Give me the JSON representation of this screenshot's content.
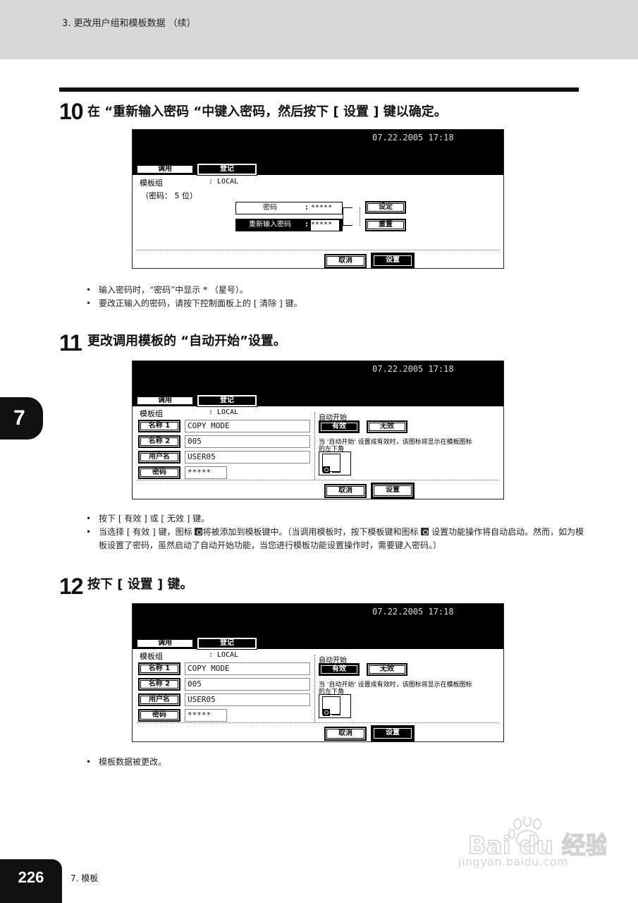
{
  "header": {
    "title": "3. 更改用户组和模板数据 （续）"
  },
  "steps": [
    {
      "num": "10",
      "text": "在 “重新输入密码 “中键入密码，然后按下 [ 设置 ] 键以确定。",
      "bullets": [
        "输入密码时，“密码”中显示 * （星号）。",
        "要改正输入的密码，请按下控制面板上的 [ 清除 ] 键。"
      ]
    },
    {
      "num": "11",
      "text": "更改调用模板的 “自动开始”设置。",
      "bullets": [
        "按下 [ 有效 ] 或 [ 无效 ] 键。",
        "当选择 [ 有效 ] 键，图标",
        "将被添加到模板键中。（当调用模板时，按下模板键和图标",
        "设置功能操作将自动启动。然而，如为模板设置了密码，虽然启动了自动开始功能，当您进行模板功能设置操作时，需要键入密码。）"
      ]
    },
    {
      "num": "12",
      "text": "按下 [ 设置 ] 键。",
      "bullets": [
        "模板数据被更改。"
      ]
    }
  ],
  "screen_common": {
    "datetime": "07.22.2005 17:18",
    "tab_call": "调用",
    "tab_register": "登记",
    "group_label": "模板组",
    "group_value": ": LOCAL",
    "btn_cancel": "取消",
    "btn_set": "设置"
  },
  "screen1": {
    "pw_hint": "（密码： 5 位）",
    "pw_label": "密码",
    "pw_value": "*****",
    "repw_label": "重新输入密码",
    "repw_value": "*****",
    "colon": ":",
    "btn_setting": "设定",
    "btn_reset": "重置"
  },
  "screen_fields": {
    "name1_label": "名称 1",
    "name1_value": "COPY MODE",
    "name2_label": "名称 2",
    "name2_value": "005",
    "user_label": "用户名",
    "user_value": "USER05",
    "pw_label": "密码",
    "pw_value": "*****",
    "auto_start_label": "自动开始",
    "btn_valid": "有效",
    "btn_invalid": "无效",
    "auto_note_1": "当 '自动开始' 设置成有效时，该图标将显示在模板图标",
    "auto_note_2": "的左下角"
  },
  "chapter_tab": "7",
  "footer": {
    "page": "226",
    "section": "7. 模板"
  },
  "watermark": {
    "logo_text": "Bai du 经验",
    "url": "jingyan.baidu.com"
  }
}
